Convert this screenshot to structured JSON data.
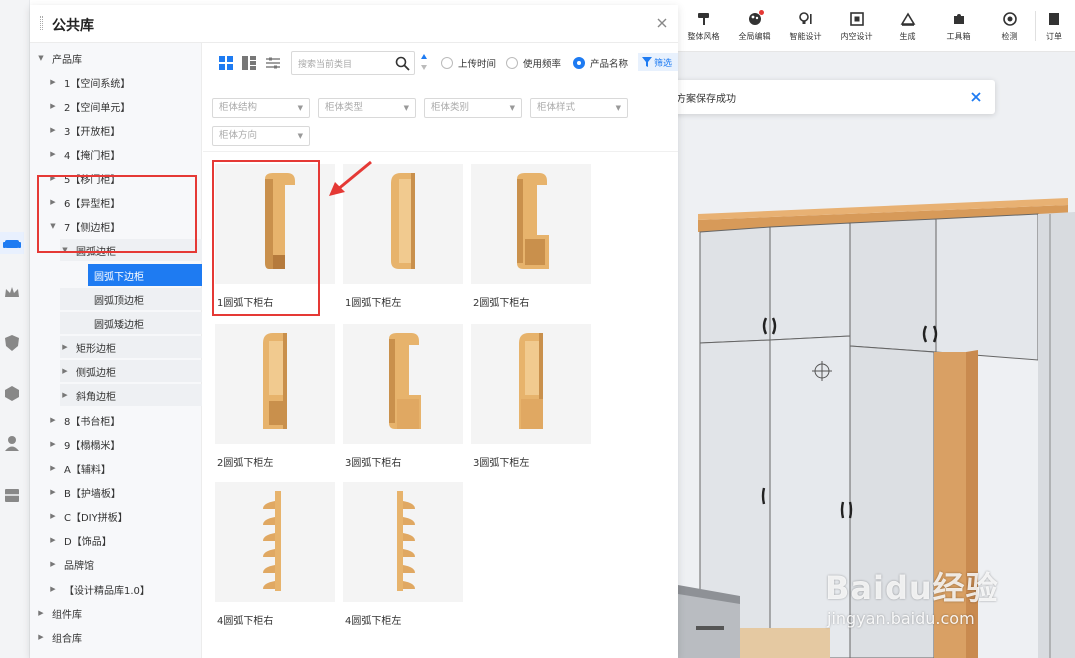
{
  "dialog": {
    "title": "公共库"
  },
  "toolbar": {
    "items": [
      {
        "label": "整体风格",
        "icon": "paint-roller-icon"
      },
      {
        "label": "全局编辑",
        "icon": "palette-icon",
        "badge": true
      },
      {
        "label": "智能设计",
        "icon": "bulb-icon"
      },
      {
        "label": "内空设计",
        "icon": "frame-icon"
      },
      {
        "label": "生成",
        "icon": "ruler-icon"
      },
      {
        "label": "工具箱",
        "icon": "puzzle-icon"
      },
      {
        "label": "检测",
        "icon": "target-icon"
      },
      {
        "label": "订单",
        "icon": "order-icon"
      }
    ]
  },
  "toast": {
    "message": "方案保存成功",
    "color": "#30b85e"
  },
  "tree": {
    "nodes": [
      {
        "label": "产品库",
        "level": 0,
        "expanded": true
      },
      {
        "label": "1【空间系统】",
        "level": 1
      },
      {
        "label": "2【空间单元】",
        "level": 1
      },
      {
        "label": "3【开放柜】",
        "level": 1
      },
      {
        "label": "4【掩门柜】",
        "level": 1
      },
      {
        "label": "5【移门柜】",
        "level": 1
      },
      {
        "label": "6【异型柜】",
        "level": 1
      },
      {
        "label": "7【侧边柜】",
        "level": 1,
        "expanded": true
      },
      {
        "label": "圆弧边柜",
        "level": 2,
        "expanded": true
      },
      {
        "label": "圆弧下边柜",
        "level": 3,
        "selected": true
      },
      {
        "label": "圆弧顶边柜",
        "level": 3
      },
      {
        "label": "圆弧矮边柜",
        "level": 3
      },
      {
        "label": "矩形边柜",
        "level": 2
      },
      {
        "label": "侧弧边柜",
        "level": 2
      },
      {
        "label": "斜角边柜",
        "level": 2
      },
      {
        "label": "8【书台柜】",
        "level": 1
      },
      {
        "label": "9【榻榻米】",
        "level": 1
      },
      {
        "label": "A【辅料】",
        "level": 1
      },
      {
        "label": "B【护墙板】",
        "level": 1
      },
      {
        "label": "C【DIY拼板】",
        "level": 1
      },
      {
        "label": "D【饰品】",
        "level": 1
      },
      {
        "label": "品牌馆",
        "level": 1
      },
      {
        "label": "【设计精品库1.0】",
        "level": 1
      },
      {
        "label": "组件库",
        "level": 0
      },
      {
        "label": "组合库",
        "level": 0
      }
    ]
  },
  "search": {
    "placeholder": "搜索当前类目"
  },
  "sort": {
    "options": [
      {
        "label": "上传时间",
        "checked": false
      },
      {
        "label": "使用频率",
        "checked": false
      },
      {
        "label": "产品名称",
        "checked": true
      }
    ]
  },
  "filter": {
    "label": "筛选"
  },
  "dropdowns": [
    "柜体结构",
    "柜体类型",
    "柜体类别",
    "柜体样式",
    "柜体方向"
  ],
  "products": [
    {
      "name": "1圆弧下柜右",
      "shape": "arc-right"
    },
    {
      "name": "1圆弧下柜左",
      "shape": "arc-left"
    },
    {
      "name": "2圆弧下柜右",
      "shape": "arc-right-box"
    },
    {
      "name": "2圆弧下柜左",
      "shape": "open-box"
    },
    {
      "name": "3圆弧下柜右",
      "shape": "arc-right-door"
    },
    {
      "name": "3圆弧下柜左",
      "shape": "open-box-door"
    },
    {
      "name": "4圆弧下柜右",
      "shape": "shelf-right"
    },
    {
      "name": "4圆弧下柜左",
      "shape": "shelf-left"
    }
  ],
  "watermark": {
    "main": "Baidu经验",
    "sub": "jingyan.baidu.com"
  },
  "colors": {
    "accent": "#1e7bf2",
    "highlight": "#e53935",
    "wood": "#e7b36c"
  }
}
